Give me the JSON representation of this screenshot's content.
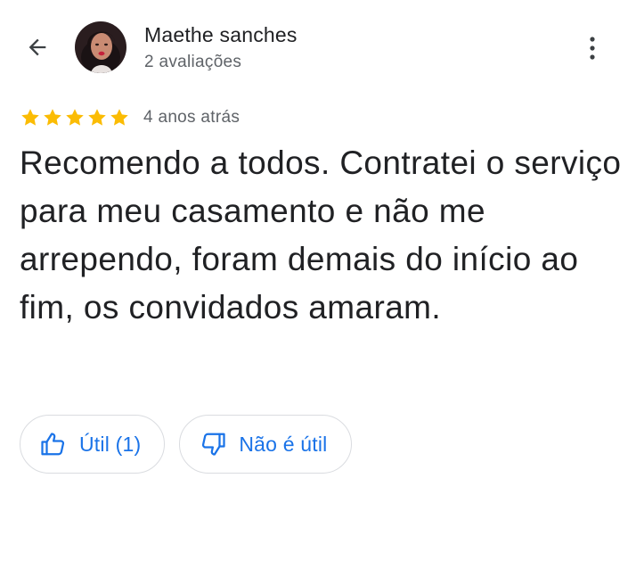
{
  "reviewer": {
    "name": "Maethe sanches",
    "review_count": "2 avaliações"
  },
  "review": {
    "rating": 5,
    "max_rating": 5,
    "date": "4 anos atrás",
    "text": "Recomendo a todos. Contratei o serviço para meu casamento e não me arrependo, foram demais do início ao fim, os convidados amaram."
  },
  "actions": {
    "helpful_label": "Útil (1)",
    "not_helpful_label": "Não é útil"
  },
  "colors": {
    "star": "#fbbc04",
    "link": "#1a73e8",
    "text": "#202124",
    "secondary_text": "#5f6368",
    "border": "#dadce0"
  },
  "icons": {
    "back": "arrow-left-icon",
    "more": "more-vertical-icon",
    "helpful": "thumb-up-icon",
    "not_helpful": "thumb-down-icon"
  }
}
